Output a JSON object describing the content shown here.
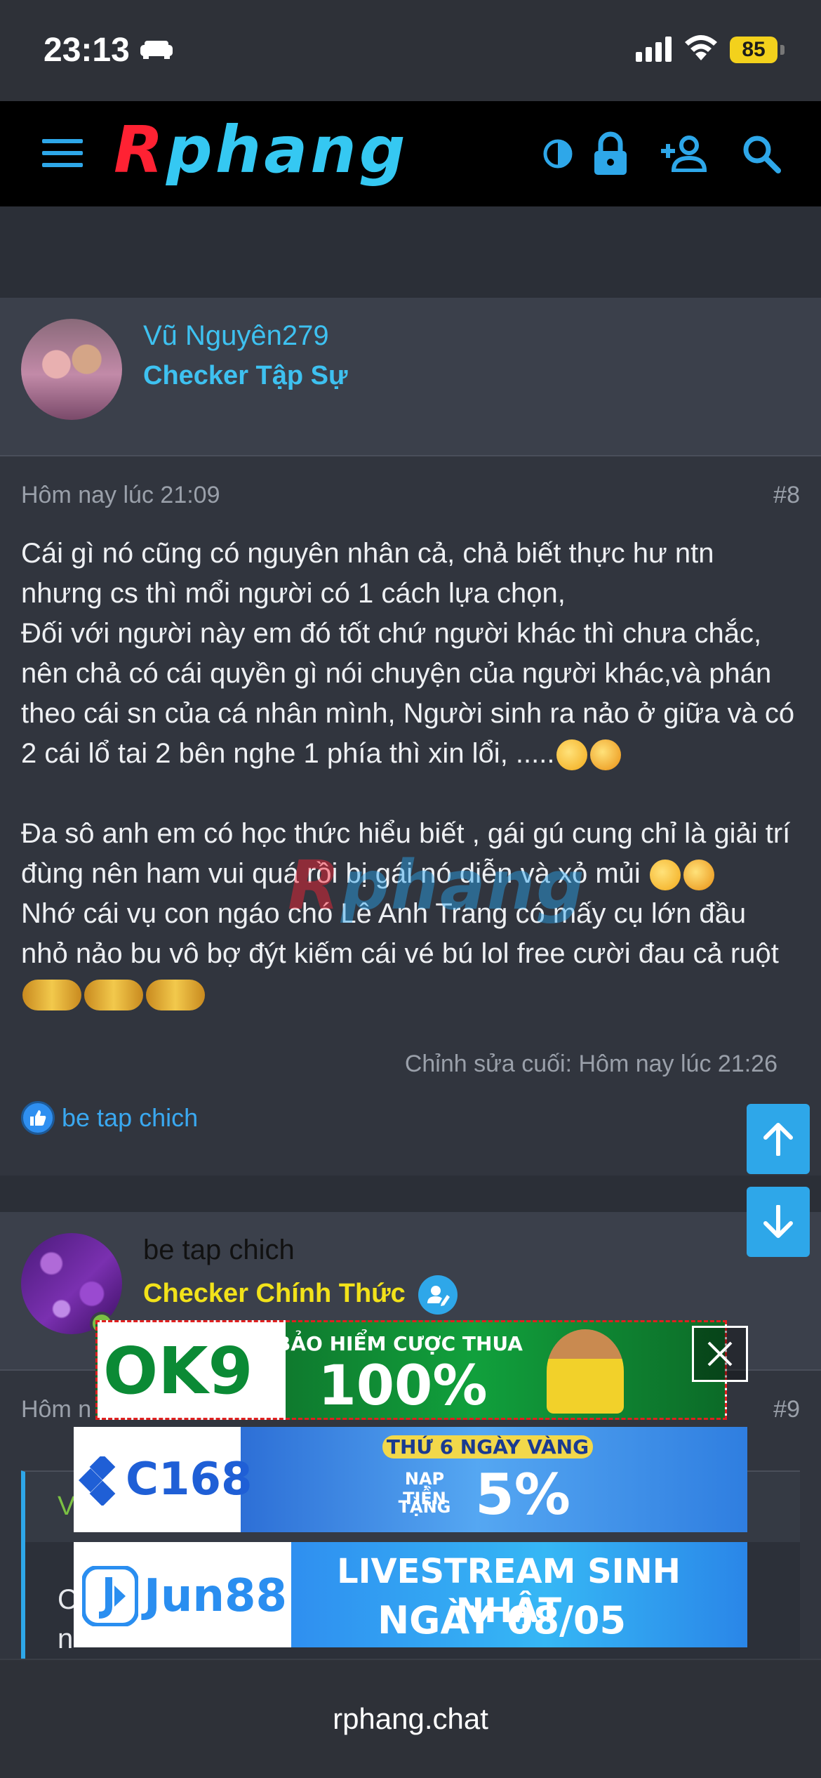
{
  "status_bar": {
    "time": "23:13",
    "battery": "85"
  },
  "header": {
    "logo_first": "R",
    "logo_rest": "phang"
  },
  "post1": {
    "username": "Vũ Nguyên279",
    "user_title": "Checker Tập Sự",
    "timestamp": "Hôm nay lúc 21:09",
    "post_number": "#8",
    "para1": "Cái gì nó cũng có nguyên nhân cả, chả biết thực hư ntn nhưng cs thì mổi người có 1 cách lựa chọn,\nĐối với người này em đó tốt chứ người khác thì chưa chắc, nên chả có cái quyền gì nói chuyện của người khác,và phán theo cái sn của cá nhân mình, Người sinh ra nảo ở giữa và có 2 cái lổ tai 2 bên nghe 1 phía thì xin lổi, .....",
    "para2a": "Đa sô anh em có học thức hiểu biết , gái gú cung chỉ là giải trí đùng nên ham vui quá rồi bị gái nó diễn và xỏ mủi",
    "para2b": "Nhớ cái vụ con ngáo chó Lê Anh Trang có mấy cụ lớn đầu nhỏ nảo bu vô bợ đýt kiếm cái vé bú lol free cười đau cả ruột",
    "edited": "Chỉnh sửa cuối: Hôm nay lúc 21:26",
    "reaction_user": "be tap chich"
  },
  "post2": {
    "username": "be tap chich",
    "user_title": "Checker Chính Thức",
    "timestamp_partial": "Hôm n",
    "post_number": "#9",
    "quote_letter": "V",
    "body_letter1": "C",
    "body_letter2": "n"
  },
  "watermark": {
    "first": "R",
    "rest": "phang"
  },
  "ads": {
    "ok9": {
      "brand": "OK9",
      "headline": "BẢO HIỂM CƯỢC THUA",
      "big": "100%"
    },
    "c168": {
      "brand": "C168",
      "headline": "THỨ 6 NGÀY VÀNG",
      "sub1": "NẠP TIỀN",
      "sub2": "TẶNG",
      "big": "5%"
    },
    "jun88": {
      "brand": "Jun88",
      "headline": "LIVESTREAM SINH NHẬT",
      "big": "NGÀY 08/05"
    }
  },
  "browser": {
    "url": "rphang.chat"
  },
  "colors": {
    "accent": "#2ea7e9",
    "title_blue": "#3ec1f0",
    "title_yellow": "#f2e21a",
    "logo_red": "#ff2233"
  }
}
